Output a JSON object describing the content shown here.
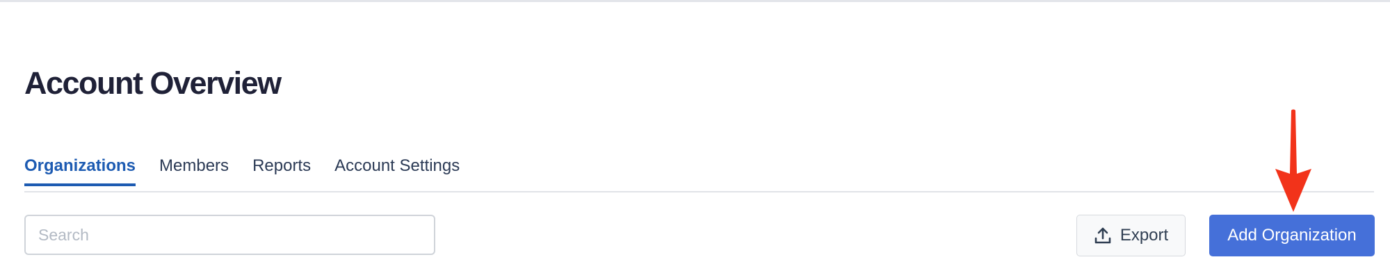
{
  "header": {
    "title": "Account Overview"
  },
  "tabs": [
    {
      "label": "Organizations",
      "active": true
    },
    {
      "label": "Members",
      "active": false
    },
    {
      "label": "Reports",
      "active": false
    },
    {
      "label": "Account Settings",
      "active": false
    }
  ],
  "toolbar": {
    "search_placeholder": "Search",
    "search_value": "",
    "export_label": "Export",
    "add_label": "Add Organization"
  },
  "icons": {
    "export": "upload-icon",
    "annotation": "red-arrow-icon"
  },
  "colors": {
    "active_tab": "#1d5bb2",
    "primary_button": "#4570d9",
    "annotation_arrow": "#f2331a"
  }
}
